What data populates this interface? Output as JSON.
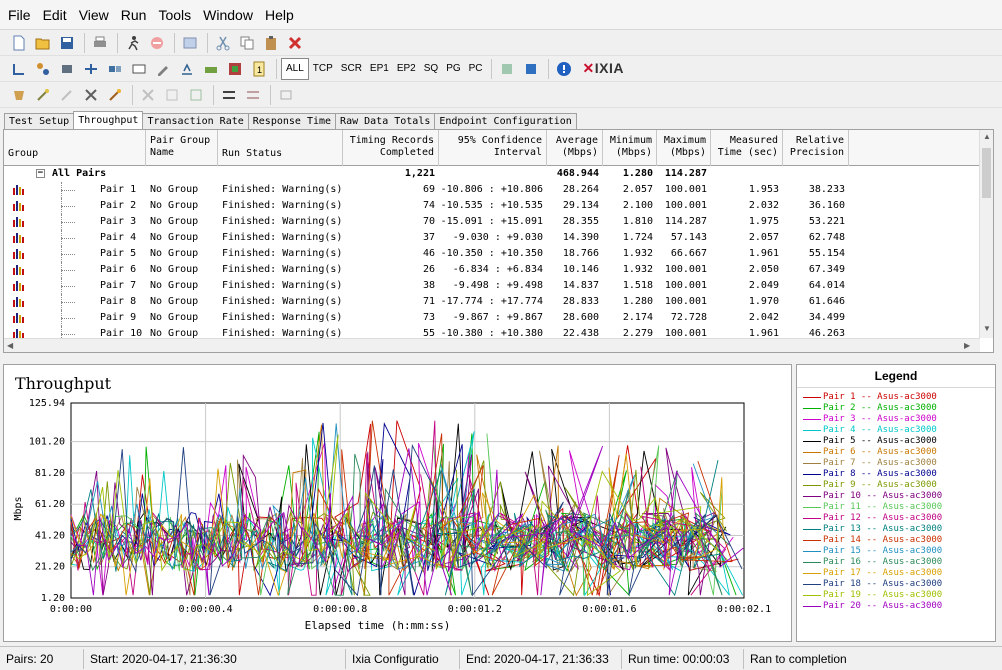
{
  "menu": [
    "File",
    "Edit",
    "View",
    "Run",
    "Tools",
    "Window",
    "Help"
  ],
  "toolbar": {
    "protocols": [
      "ALL",
      "TCP",
      "SCR",
      "EP1",
      "EP2",
      "SQ",
      "PG",
      "PC"
    ],
    "brand": "IXIA"
  },
  "tabs": [
    "Test Setup",
    "Throughput",
    "Transaction Rate",
    "Response Time",
    "Raw Data Totals",
    "Endpoint Configuration"
  ],
  "grid": {
    "headers": {
      "group": "Group",
      "pair_group_name": "Pair Group\nName",
      "run_status": "Run Status",
      "timing_records": "Timing Records\nCompleted",
      "confidence": "95% Confidence\nInterval",
      "average": "Average\n(Mbps)",
      "minimum": "Minimum\n(Mbps)",
      "maximum": "Maximum\n(Mbps)",
      "measured": "Measured\nTime (sec)",
      "precision": "Relative\nPrecision"
    },
    "summary": {
      "label": "All Pairs",
      "records": "1,221",
      "average": "468.944",
      "minimum": "1.280",
      "maximum": "114.287"
    },
    "rows": [
      {
        "pair": "Pair 1",
        "group": "No Group",
        "status": "Finished: Warning(s)",
        "records": "69",
        "ci": "-10.806 : +10.806",
        "avg": "28.264",
        "min": "2.057",
        "max": "100.001",
        "time": "1.953",
        "prec": "38.233"
      },
      {
        "pair": "Pair 2",
        "group": "No Group",
        "status": "Finished: Warning(s)",
        "records": "74",
        "ci": "-10.535 : +10.535",
        "avg": "29.134",
        "min": "2.100",
        "max": "100.001",
        "time": "2.032",
        "prec": "36.160"
      },
      {
        "pair": "Pair 3",
        "group": "No Group",
        "status": "Finished: Warning(s)",
        "records": "70",
        "ci": "-15.091 : +15.091",
        "avg": "28.355",
        "min": "1.810",
        "max": "114.287",
        "time": "1.975",
        "prec": "53.221"
      },
      {
        "pair": "Pair 4",
        "group": "No Group",
        "status": "Finished: Warning(s)",
        "records": "37",
        "ci": "-9.030 : +9.030",
        "avg": "14.390",
        "min": "1.724",
        "max": "57.143",
        "time": "2.057",
        "prec": "62.748"
      },
      {
        "pair": "Pair 5",
        "group": "No Group",
        "status": "Finished: Warning(s)",
        "records": "46",
        "ci": "-10.350 : +10.350",
        "avg": "18.766",
        "min": "1.932",
        "max": "66.667",
        "time": "1.961",
        "prec": "55.154"
      },
      {
        "pair": "Pair 6",
        "group": "No Group",
        "status": "Finished: Warning(s)",
        "records": "26",
        "ci": "-6.834 : +6.834",
        "avg": "10.146",
        "min": "1.932",
        "max": "100.001",
        "time": "2.050",
        "prec": "67.349"
      },
      {
        "pair": "Pair 7",
        "group": "No Group",
        "status": "Finished: Warning(s)",
        "records": "38",
        "ci": "-9.498 : +9.498",
        "avg": "14.837",
        "min": "1.518",
        "max": "100.001",
        "time": "2.049",
        "prec": "64.014"
      },
      {
        "pair": "Pair 8",
        "group": "No Group",
        "status": "Finished: Warning(s)",
        "records": "71",
        "ci": "-17.774 : +17.774",
        "avg": "28.833",
        "min": "1.280",
        "max": "100.001",
        "time": "1.970",
        "prec": "61.646"
      },
      {
        "pair": "Pair 9",
        "group": "No Group",
        "status": "Finished: Warning(s)",
        "records": "73",
        "ci": "-9.867 : +9.867",
        "avg": "28.600",
        "min": "2.174",
        "max": "72.728",
        "time": "2.042",
        "prec": "34.499"
      },
      {
        "pair": "Pair 10",
        "group": "No Group",
        "status": "Finished: Warning(s)",
        "records": "55",
        "ci": "-10.380 : +10.380",
        "avg": "22.438",
        "min": "2.279",
        "max": "100.001",
        "time": "1.961",
        "prec": "46.263"
      }
    ]
  },
  "chart_data": {
    "type": "line",
    "title": "Throughput",
    "xlabel": "Elapsed time (h:mm:ss)",
    "ylabel": "Mbps",
    "x_ticks": [
      "0:00:00",
      "0:00:00.4",
      "0:00:00.8",
      "0:00:01.2",
      "0:00:01.6",
      "0:00:02.1"
    ],
    "y_ticks": [
      "1.20",
      "21.20",
      "41.20",
      "61.20",
      "81.20",
      "101.20",
      "125.94"
    ],
    "xlim": [
      0,
      2.1
    ],
    "ylim": [
      1.2,
      125.94
    ],
    "grid": true,
    "legend": "right panel",
    "series_count": 20
  },
  "legend": {
    "title": "Legend",
    "items": [
      {
        "label": "Pair 1 -- Asus-ac3000",
        "color": "#cc0000"
      },
      {
        "label": "Pair 2 -- Asus-ac3000",
        "color": "#00b000"
      },
      {
        "label": "Pair 3 -- Asus-ac3000",
        "color": "#cc00cc"
      },
      {
        "label": "Pair 4 -- Asus-ac3000",
        "color": "#00c8c8"
      },
      {
        "label": "Pair 5 -- Asus-ac3000",
        "color": "#000000"
      },
      {
        "label": "Pair 6 -- Asus-ac3000",
        "color": "#c87800"
      },
      {
        "label": "Pair 7 -- Asus-ac3000",
        "color": "#a08040"
      },
      {
        "label": "Pair 8 -- Asus-ac3000",
        "color": "#000090"
      },
      {
        "label": "Pair 9 -- Asus-ac3000",
        "color": "#7a9a00"
      },
      {
        "label": "Pair 10 -- Asus-ac3000",
        "color": "#800080"
      },
      {
        "label": "Pair 11 -- Asus-ac3000",
        "color": "#58c858"
      },
      {
        "label": "Pair 12 -- Asus-ac3000",
        "color": "#c00080"
      },
      {
        "label": "Pair 13 -- Asus-ac3000",
        "color": "#008080"
      },
      {
        "label": "Pair 14 -- Asus-ac3000",
        "color": "#c83000"
      },
      {
        "label": "Pair 15 -- Asus-ac3000",
        "color": "#2090c0"
      },
      {
        "label": "Pair 16 -- Asus-ac3000",
        "color": "#2a8a5a"
      },
      {
        "label": "Pair 17 -- Asus-ac3000",
        "color": "#d8a000"
      },
      {
        "label": "Pair 18 -- Asus-ac3000",
        "color": "#204080"
      },
      {
        "label": "Pair 19 -- Asus-ac3000",
        "color": "#a0c000"
      },
      {
        "label": "Pair 20 -- Asus-ac3000",
        "color": "#a000c0"
      }
    ]
  },
  "status": {
    "pairs": "Pairs: 20",
    "start": "Start: 2020-04-17, 21:36:30",
    "config": "Ixia Configuratio",
    "end": "End: 2020-04-17, 21:36:33",
    "runtime": "Run time: 00:00:03",
    "result": "Ran to completion"
  }
}
